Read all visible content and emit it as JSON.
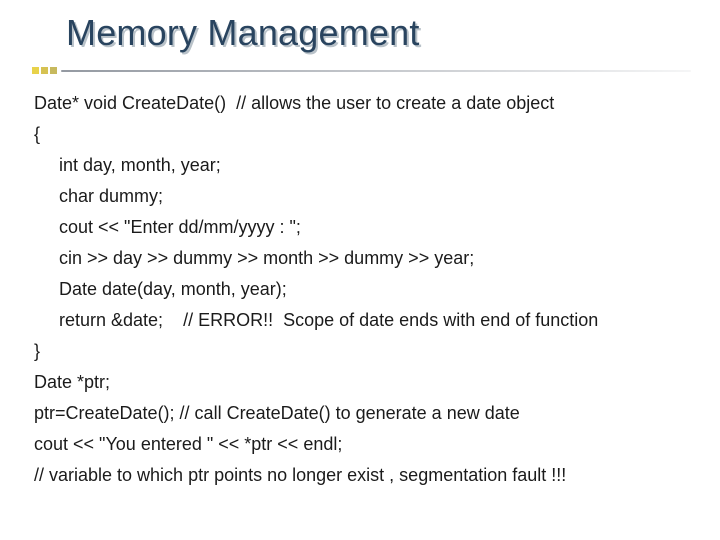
{
  "title": "Memory Management",
  "code": {
    "l1": "Date* void CreateDate()  // allows the user to create a date object",
    "l2": "{",
    "l3": "int day, month, year;",
    "l4": "char dummy;",
    "l5": "cout << \"Enter dd/mm/yyyy : \";",
    "l6": "cin >> day >> dummy >> month >> dummy >> year;",
    "l7": "Date date(day, month, year);",
    "l8": "return &date;    // ERROR!!  Scope of date ends with end of function",
    "l9": "}",
    "l10": "Date *ptr;",
    "l11": "ptr=CreateDate(); // call CreateDate() to generate a new date",
    "l12": "cout << \"You entered \" << *ptr << endl;",
    "l13": "// variable to which ptr points no longer exist , segmentation fault !!!"
  }
}
